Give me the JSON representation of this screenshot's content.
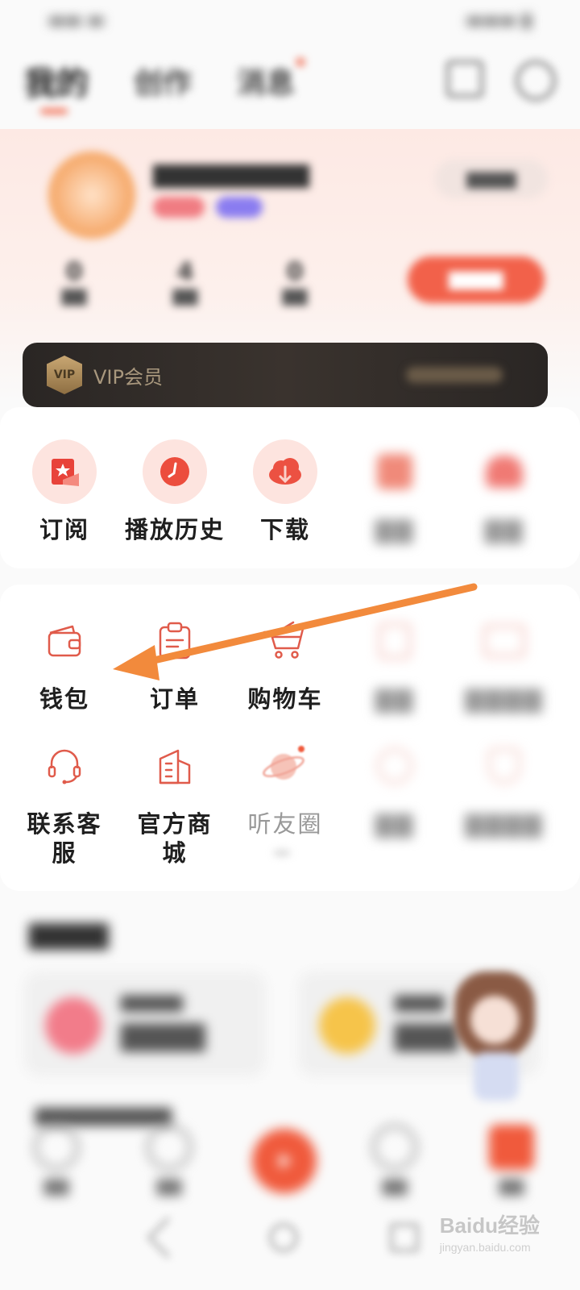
{
  "top_nav": {
    "tabs": [
      "我的",
      "创作",
      "消息"
    ],
    "active_tab": "我的"
  },
  "profile": {
    "vip_label": "VIP会员",
    "vip_badge_text": "VIP"
  },
  "quick_row": [
    {
      "label": "订阅",
      "icon": "subscribe-icon",
      "visible": true
    },
    {
      "label": "播放历史",
      "icon": "history-clock-icon",
      "visible": true
    },
    {
      "label": "下载",
      "icon": "download-cloud-icon",
      "visible": true
    },
    {
      "label": "",
      "icon": "blurred-icon",
      "visible": false
    },
    {
      "label": "",
      "icon": "heart-icon",
      "visible": false
    }
  ],
  "tools_row1": [
    {
      "label": "钱包",
      "icon": "wallet-icon"
    },
    {
      "label": "订单",
      "icon": "clipboard-icon"
    },
    {
      "label": "购物车",
      "icon": "cart-icon"
    },
    {
      "label": "",
      "icon": "blurred-icon"
    },
    {
      "label": "",
      "icon": "blurred-icon"
    }
  ],
  "tools_row2": [
    {
      "label_lines": [
        "联系客",
        "服"
      ],
      "icon": "headset-icon"
    },
    {
      "label_lines": [
        "官方商",
        "城"
      ],
      "icon": "building-icon"
    },
    {
      "label_lines": [
        "听友圈"
      ],
      "icon": "planet-icon"
    },
    {
      "label_lines": [
        ""
      ],
      "icon": "blurred-icon"
    },
    {
      "label_lines": [
        ""
      ],
      "icon": "blurred-icon"
    }
  ],
  "watermark": {
    "brand": "Baidu经验",
    "url": "jingyan.baidu.com"
  },
  "colors": {
    "accent": "#f05a3c",
    "arrow": "#f28a3c",
    "icon_stroke": "#e05b4b"
  }
}
